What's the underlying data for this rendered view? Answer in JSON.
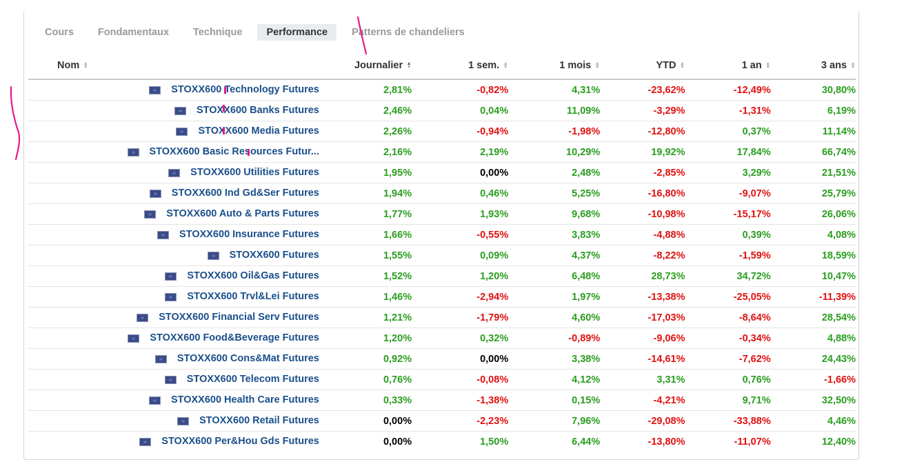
{
  "tabs": [
    {
      "label": "Cours",
      "active": false
    },
    {
      "label": "Fondamentaux",
      "active": false
    },
    {
      "label": "Technique",
      "active": false
    },
    {
      "label": "Performance",
      "active": true
    },
    {
      "label": "Patterns de chandeliers",
      "active": false
    }
  ],
  "headers": {
    "name": "Nom",
    "daily": "Journalier",
    "week": "1 sem.",
    "month": "1 mois",
    "ytd": "YTD",
    "year": "1 an",
    "three_years": "3 ans"
  },
  "rows": [
    {
      "name": "STOXX600 Technology Futures",
      "d": "2,81%",
      "w": "-0,82%",
      "m": "4,31%",
      "ytd": "-23,62%",
      "y1": "-12,49%",
      "y3": "30,80%"
    },
    {
      "name": "STOXX600 Banks Futures",
      "d": "2,46%",
      "w": "0,04%",
      "m": "11,09%",
      "ytd": "-3,29%",
      "y1": "-1,31%",
      "y3": "6,19%"
    },
    {
      "name": "STOXX600 Media Futures",
      "d": "2,26%",
      "w": "-0,94%",
      "m": "-1,98%",
      "ytd": "-12,80%",
      "y1": "0,37%",
      "y3": "11,14%"
    },
    {
      "name": "STOXX600 Basic Resources Futur...",
      "d": "2,16%",
      "w": "2,19%",
      "m": "10,29%",
      "ytd": "19,92%",
      "y1": "17,84%",
      "y3": "66,74%"
    },
    {
      "name": "STOXX600 Utilities Futures",
      "d": "1,95%",
      "w": "0,00%",
      "m": "2,48%",
      "ytd": "-2,85%",
      "y1": "3,29%",
      "y3": "21,51%"
    },
    {
      "name": "STOXX600 Ind Gd&Ser Futures",
      "d": "1,94%",
      "w": "0,46%",
      "m": "5,25%",
      "ytd": "-16,80%",
      "y1": "-9,07%",
      "y3": "25,79%"
    },
    {
      "name": "STOXX600 Auto & Parts Futures",
      "d": "1,77%",
      "w": "1,93%",
      "m": "9,68%",
      "ytd": "-10,98%",
      "y1": "-15,17%",
      "y3": "26,06%"
    },
    {
      "name": "STOXX600 Insurance Futures",
      "d": "1,66%",
      "w": "-0,55%",
      "m": "3,83%",
      "ytd": "-4,88%",
      "y1": "0,39%",
      "y3": "4,08%"
    },
    {
      "name": "STOXX600 Futures",
      "d": "1,55%",
      "w": "0,09%",
      "m": "4,37%",
      "ytd": "-8,22%",
      "y1": "-1,59%",
      "y3": "18,59%"
    },
    {
      "name": "STOXX600 Oil&Gas Futures",
      "d": "1,52%",
      "w": "1,20%",
      "m": "6,48%",
      "ytd": "28,73%",
      "y1": "34,72%",
      "y3": "10,47%"
    },
    {
      "name": "STOXX600 Trvl&Lei Futures",
      "d": "1,46%",
      "w": "-2,94%",
      "m": "1,97%",
      "ytd": "-13,38%",
      "y1": "-25,05%",
      "y3": "-11,39%"
    },
    {
      "name": "STOXX600 Financial Serv Futures",
      "d": "1,21%",
      "w": "-1,79%",
      "m": "4,60%",
      "ytd": "-17,03%",
      "y1": "-8,64%",
      "y3": "28,54%"
    },
    {
      "name": "STOXX600 Food&Beverage Futures",
      "d": "1,20%",
      "w": "0,32%",
      "m": "-0,89%",
      "ytd": "-9,06%",
      "y1": "-0,34%",
      "y3": "4,88%"
    },
    {
      "name": "STOXX600 Cons&Mat Futures",
      "d": "0,92%",
      "w": "0,00%",
      "m": "3,38%",
      "ytd": "-14,61%",
      "y1": "-7,62%",
      "y3": "24,43%"
    },
    {
      "name": "STOXX600 Telecom Futures",
      "d": "0,76%",
      "w": "-0,08%",
      "m": "4,12%",
      "ytd": "3,31%",
      "y1": "0,76%",
      "y3": "-1,66%"
    },
    {
      "name": "STOXX600 Health Care Futures",
      "d": "0,33%",
      "w": "-1,38%",
      "m": "0,15%",
      "ytd": "-4,21%",
      "y1": "9,71%",
      "y3": "32,50%"
    },
    {
      "name": "STOXX600 Retail Futures",
      "d": "0,00%",
      "w": "-2,23%",
      "m": "7,96%",
      "ytd": "-29,08%",
      "y1": "-33,88%",
      "y3": "4,46%"
    },
    {
      "name": "STOXX600 Per&Hou Gds Futures",
      "d": "0,00%",
      "w": "1,50%",
      "m": "6,44%",
      "ytd": "-13,80%",
      "y1": "-11,07%",
      "y3": "12,40%"
    }
  ],
  "colors": {
    "positive": "#2a9d1f",
    "negative": "#e01010",
    "zero": "#000000",
    "link": "#1a4f8a",
    "annotation": "#e6198a"
  },
  "icons": {
    "row_flag": "eu-flag-icon",
    "sort": "sort-arrows-icon"
  }
}
